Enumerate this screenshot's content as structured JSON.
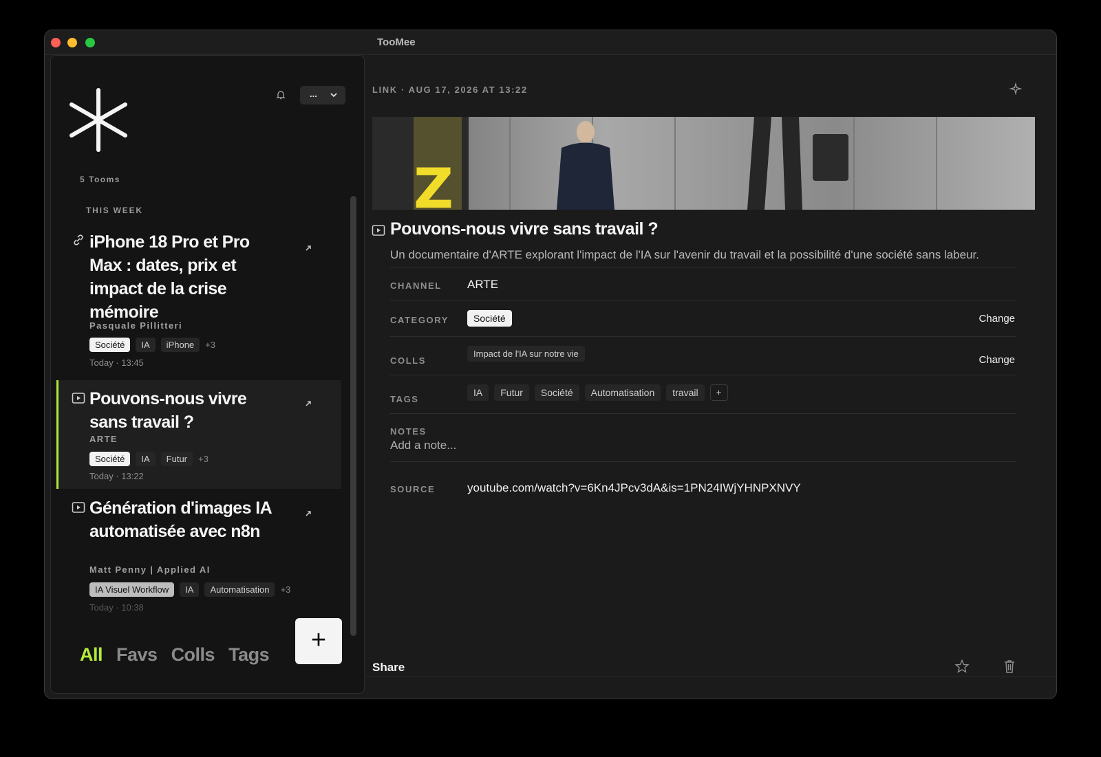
{
  "window": {
    "title": "TooMee"
  },
  "sidebar": {
    "menu_label": "...",
    "count": "5 Tooms",
    "section": "THIS WEEK",
    "items": [
      {
        "kind_icon": "link-icon",
        "title": "iPhone 18 Pro et Pro Max : dates, prix et impact de la crise mémoire",
        "author": "Pasquale Pillitteri",
        "tags": [
          "Société",
          "IA",
          "iPhone"
        ],
        "more": "+3",
        "time": "Today · 13:45"
      },
      {
        "kind_icon": "video-icon",
        "title": "Pouvons-nous vivre sans travail ?",
        "author": "ARTE",
        "tags": [
          "Société",
          "IA",
          "Futur"
        ],
        "more": "+3",
        "time": "Today · 13:22"
      },
      {
        "kind_icon": "video-icon",
        "title": "Génération d'images IA automatisée avec n8n",
        "author": "Matt Penny | Applied AI",
        "tags": [
          "IA Visuel Workflow",
          "IA",
          "Automatisation"
        ],
        "more": "+3",
        "time": "Today · 10:38"
      }
    ],
    "nav": [
      "All",
      "Favs",
      "Colls",
      "Tags"
    ],
    "add_label": "+"
  },
  "detail": {
    "meta": "LINK · AUG 17, 2026 AT 13:22",
    "title": "Pouvons-nous vivre sans travail ?",
    "description": "Un documentaire d'ARTE explorant l'impact de l'IA sur l'avenir du travail et la possibilité d'une société sans labeur.",
    "channel_label": "CHANNEL",
    "channel": "ARTE",
    "category_label": "CATEGORY",
    "category": "Société",
    "colls_label": "COLLS",
    "colls": [
      "Impact de l'IA sur notre vie"
    ],
    "tags_label": "TAGS",
    "tags": [
      "IA",
      "Futur",
      "Société",
      "Automatisation",
      "travail"
    ],
    "tags_add": "+",
    "notes_label": "NOTES",
    "notes_placeholder": "Add a note...",
    "source_label": "SOURCE",
    "source": "youtube.com/watch?v=6Kn4JPcv3dA&is=1PN24IWjYHNPXNVY",
    "change_label": "Change",
    "share_label": "Share",
    "banner_text": "Z"
  },
  "colors": {
    "accent": "#b4ea3b",
    "background": "#1b1b1b",
    "sidebar": "#141414"
  }
}
